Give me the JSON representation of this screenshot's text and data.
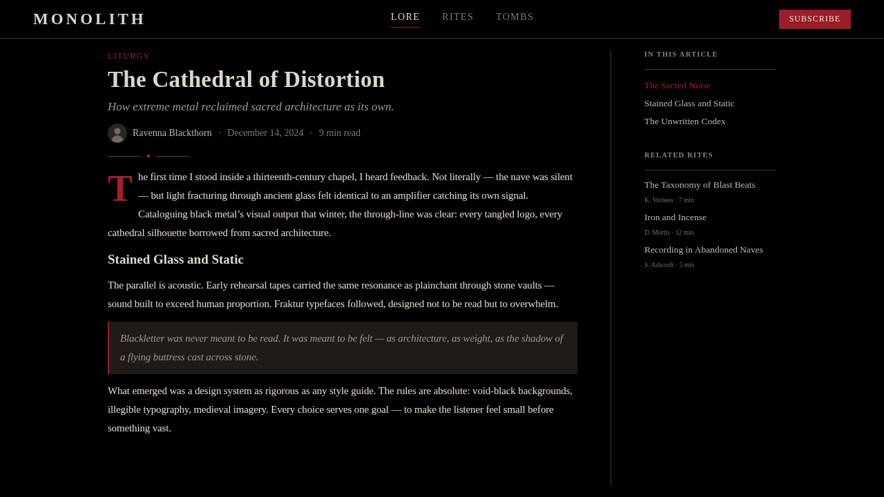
{
  "header": {
    "logo": "MONOLITH",
    "nav": [
      {
        "label": "LORE",
        "selected": true
      },
      {
        "label": "RITES",
        "selected": false
      },
      {
        "label": "TOMBS",
        "selected": false
      }
    ],
    "subscribe_button": "SUBSCRIBE"
  },
  "article": {
    "category": "LITURGY",
    "title": "The Cathedral of Distortion",
    "subtitle": "How extreme metal reclaimed sacred architecture as its own.",
    "byline": {
      "author": "Ravenna Blackthorn",
      "separator": "·",
      "date": "December 14, 2024",
      "read_time": "9 min read"
    },
    "body": [
      {
        "kind": "lead",
        "drop_cap": "T",
        "text": "he first time I stood inside a thirteenth-century chapel, I heard feedback. Not literally — the nave was silent — but light fracturing through ancient glass felt identical to an amplifier catching its own signal. Cataloguing black metal’s visual output that winter, the through-line was clear: every tangled logo, every cathedral silhouette borrowed from sacred architecture."
      },
      {
        "kind": "heading",
        "text": "Stained Glass and Static"
      },
      {
        "kind": "paragraph",
        "text": "The parallel is acoustic. Early rehearsal tapes carried the same resonance as plainchant through stone vaults — sound built to exceed human proportion. Fraktur typefaces followed, designed not to be read but to overwhelm."
      },
      {
        "kind": "quote",
        "text": "Blackletter was never meant to be read. It was meant to be felt — as architecture, as weight, as the shadow of a flying buttress cast across stone."
      },
      {
        "kind": "paragraph",
        "text": "What emerged was a design system as rigorous as any style guide. The rules are absolute: void-black backgrounds, illegible typography, medieval imagery. Every choice serves one goal — to make the listener feel small before something vast."
      }
    ]
  },
  "sidebar": {
    "toc": {
      "heading": "IN THIS ARTICLE",
      "items": [
        {
          "label": "The Sacred Noise",
          "selected": true
        },
        {
          "label": "Stained Glass and Static",
          "selected": false
        },
        {
          "label": "The Unwritten Codex",
          "selected": false
        }
      ]
    },
    "related": {
      "heading": "RELATED RITES",
      "items": [
        {
          "title": "The Taxonomy of Blast Beats",
          "meta": "K. Vorhees · 7 min"
        },
        {
          "title": "Iron and Incense",
          "meta": "D. Mortis · 12 min"
        },
        {
          "title": "Recording in Abandoned Naves",
          "meta": "S. Ashcroft · 5 min"
        }
      ]
    }
  }
}
